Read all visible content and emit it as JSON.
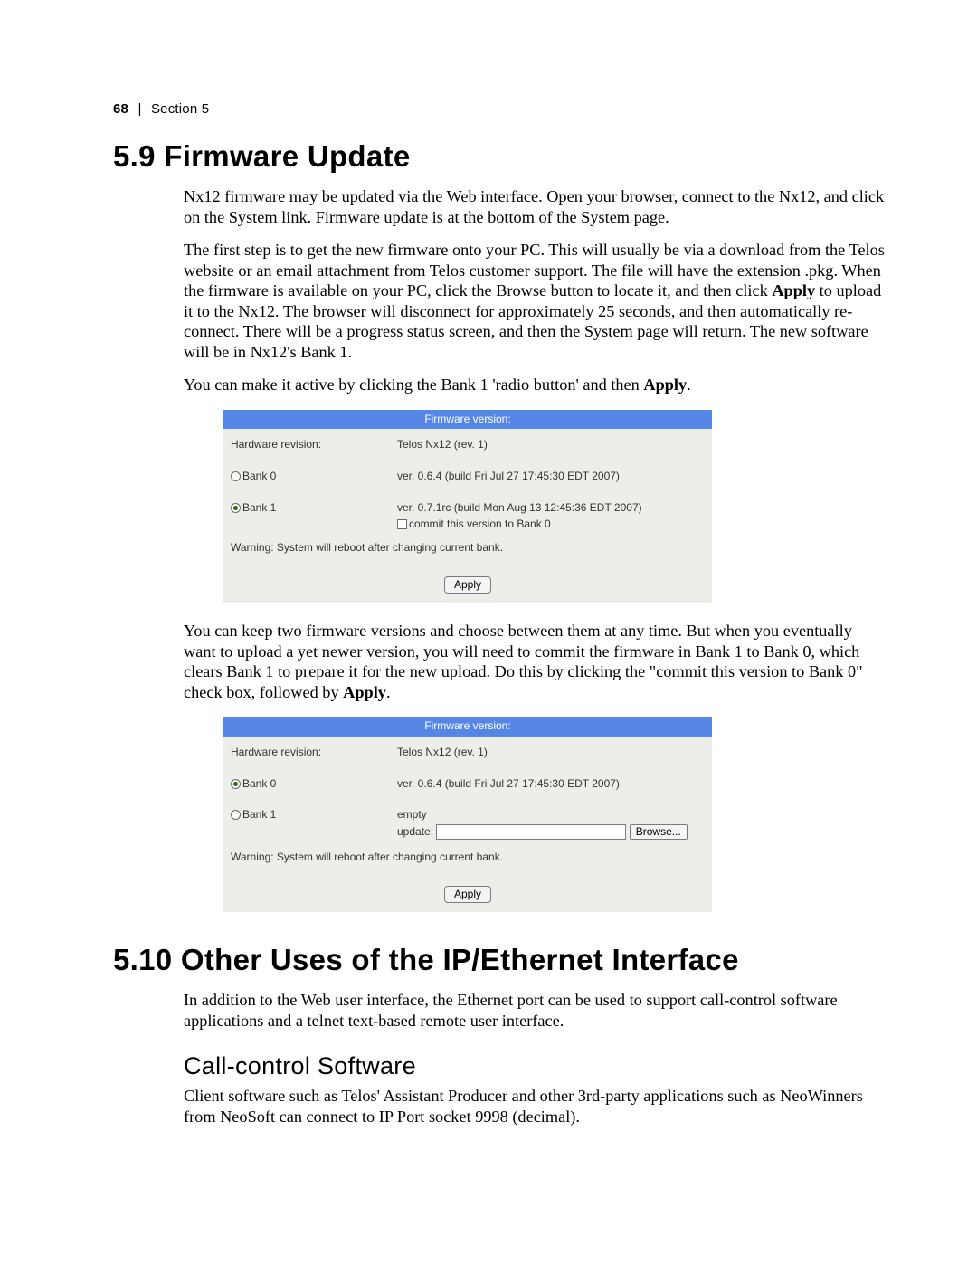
{
  "header": {
    "page_number": "68",
    "separator": "|",
    "section_label": "Section 5"
  },
  "s59": {
    "title": "5.9  Firmware Update",
    "p1": "Nx12 firmware may be updated via the Web interface. Open your browser, connect to the Nx12, and click on the System link. Firmware update is at the bottom of the System page.",
    "p2a": "The first step is to get the new firmware onto your PC. This will usually be via a download from the Telos website or an email attachment from Telos customer support. The file will have the extension .pkg. When the firmware is available on your PC, click the Browse button to locate it, and then click ",
    "p2b_bold": "Apply",
    "p2c": " to upload it to the Nx12. The browser will disconnect for approximately 25 seconds, and then automatically re-connect. There will be a progress status screen, and then the System page will return. The new software will be in Nx12's Bank 1.",
    "p3a": "You can make it active by clicking the Bank 1 'radio button' and then ",
    "p3b_bold": "Apply",
    "p3c": ".",
    "p4a": "You can keep two firmware versions and choose between them at any time. But when you eventually want to upload a yet newer version, you will need to commit the firmware in Bank 1 to Bank 0, which clears Bank 1 to prepare it for the new upload. Do this by clicking the \"commit this version to Bank 0\" check box, followed by ",
    "p4b_bold": "Apply",
    "p4c": "."
  },
  "panel1": {
    "header": "Firmware version:",
    "hw_label": "Hardware revision:",
    "hw_value": "Telos Nx12 (rev. 1)",
    "bank0_label": "Bank 0",
    "bank0_value": "ver. 0.6.4 (build Fri Jul 27 17:45:30 EDT 2007)",
    "bank1_label": "Bank 1",
    "bank1_value": "ver. 0.7.1rc (build Mon Aug 13 12:45:36 EDT 2007)",
    "commit_label": "commit this version to Bank 0",
    "warning": "Warning: System will reboot after changing current bank.",
    "apply": "Apply"
  },
  "panel2": {
    "header": "Firmware version:",
    "hw_label": "Hardware revision:",
    "hw_value": "Telos Nx12 (rev. 1)",
    "bank0_label": "Bank 0",
    "bank0_value": "ver. 0.6.4 (build Fri Jul 27 17:45:30 EDT 2007)",
    "bank1_label": "Bank 1",
    "bank1_empty": "empty",
    "update_label": "update:",
    "browse": "Browse...",
    "warning": "Warning: System will reboot after changing current bank.",
    "apply": "Apply"
  },
  "s510": {
    "title": "5.10  Other Uses of the IP/Ethernet Interface",
    "p1": "In addition to the Web user interface, the Ethernet port can be used to support call-control software applications and a telnet text-based remote user interface.",
    "sub_title": "Call-control Software",
    "p2": "Client software such as Telos' Assistant Producer and other 3rd-party applications such as NeoWinners from NeoSoft can connect to IP Port socket 9998 (decimal)."
  }
}
